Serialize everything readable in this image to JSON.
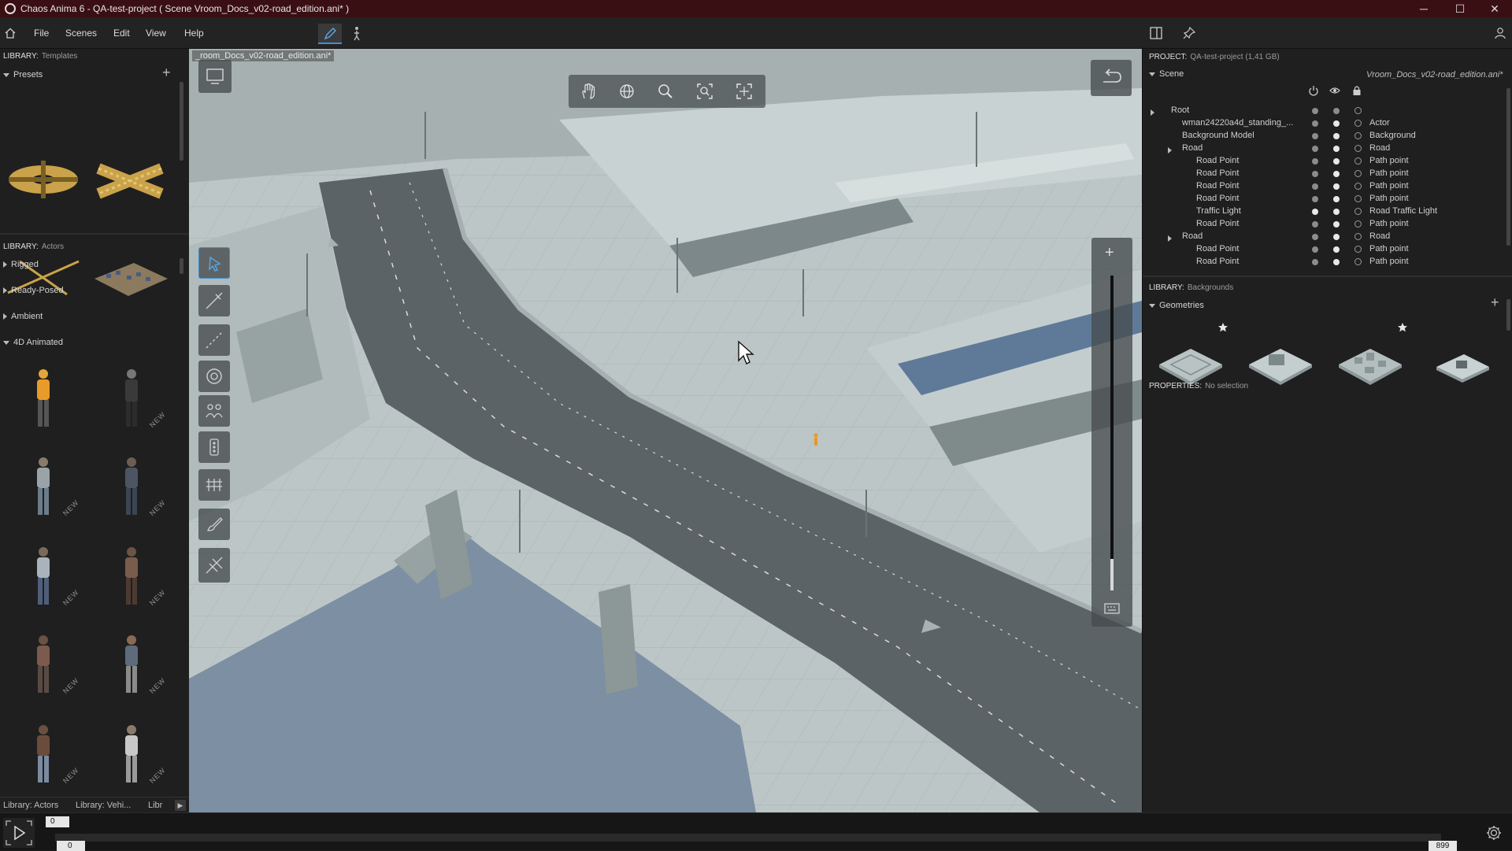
{
  "window": {
    "title": "Chaos Anima 6 -   QA-test-project ( Scene Vroom_Docs_v02-road_edition.ani* )",
    "minimize": "─",
    "maximize": "☐",
    "close": "✕"
  },
  "menu": {
    "items": [
      "File",
      "Scenes",
      "Edit",
      "View",
      "Help"
    ]
  },
  "left": {
    "templates_label": "LIBRARY:",
    "templates_sub": "Templates",
    "presets_label": "Presets",
    "actors_label": "LIBRARY:",
    "actors_sub": "Actors",
    "categories": [
      "Rigged",
      "Ready-Posed",
      "Ambient",
      "4D Animated"
    ],
    "new_tag": "NEW",
    "bottom_tabs": [
      "Library: Actors",
      "Library: Vehi...",
      "Libr"
    ]
  },
  "viewport": {
    "tab_label": "_room_Docs_v02-road_edition.ani*"
  },
  "right": {
    "project_label": "PROJECT:",
    "project_value": "QA-test-project (1,41 GB)",
    "scene_label": "Scene",
    "scene_file": "Vroom_Docs_v02-road_edition.ani*",
    "tree": [
      {
        "name": "Root",
        "indent": 0,
        "arrow": true,
        "type": ""
      },
      {
        "name": "wman24220a4d_standing_...",
        "indent": 1,
        "arrow": false,
        "type": "Actor"
      },
      {
        "name": "Background Model",
        "indent": 1,
        "arrow": false,
        "type": "Background"
      },
      {
        "name": "Road",
        "indent": 1,
        "arrow": true,
        "type": "Road"
      },
      {
        "name": "Road Point",
        "indent": 2,
        "arrow": false,
        "type": "Path point"
      },
      {
        "name": "Road Point",
        "indent": 2,
        "arrow": false,
        "type": "Path point"
      },
      {
        "name": "Road Point",
        "indent": 2,
        "arrow": false,
        "type": "Path point"
      },
      {
        "name": "Road Point",
        "indent": 2,
        "arrow": false,
        "type": "Path point"
      },
      {
        "name": "Traffic Light",
        "indent": 2,
        "arrow": false,
        "type": "Road Traffic Light"
      },
      {
        "name": "Road Point",
        "indent": 2,
        "arrow": false,
        "type": "Path point"
      },
      {
        "name": "Road",
        "indent": 1,
        "arrow": true,
        "type": "Road"
      },
      {
        "name": "Road Point",
        "indent": 2,
        "arrow": false,
        "type": "Path point"
      },
      {
        "name": "Road Point",
        "indent": 2,
        "arrow": false,
        "type": "Path point"
      }
    ],
    "backgrounds_label": "LIBRARY:",
    "backgrounds_sub": "Backgrounds",
    "geometries_label": "Geometries",
    "properties_label": "PROPERTIES:",
    "properties_value": "No selection"
  },
  "timeline": {
    "current_frame": "0",
    "start_frame": "0",
    "end_frame": "899"
  }
}
